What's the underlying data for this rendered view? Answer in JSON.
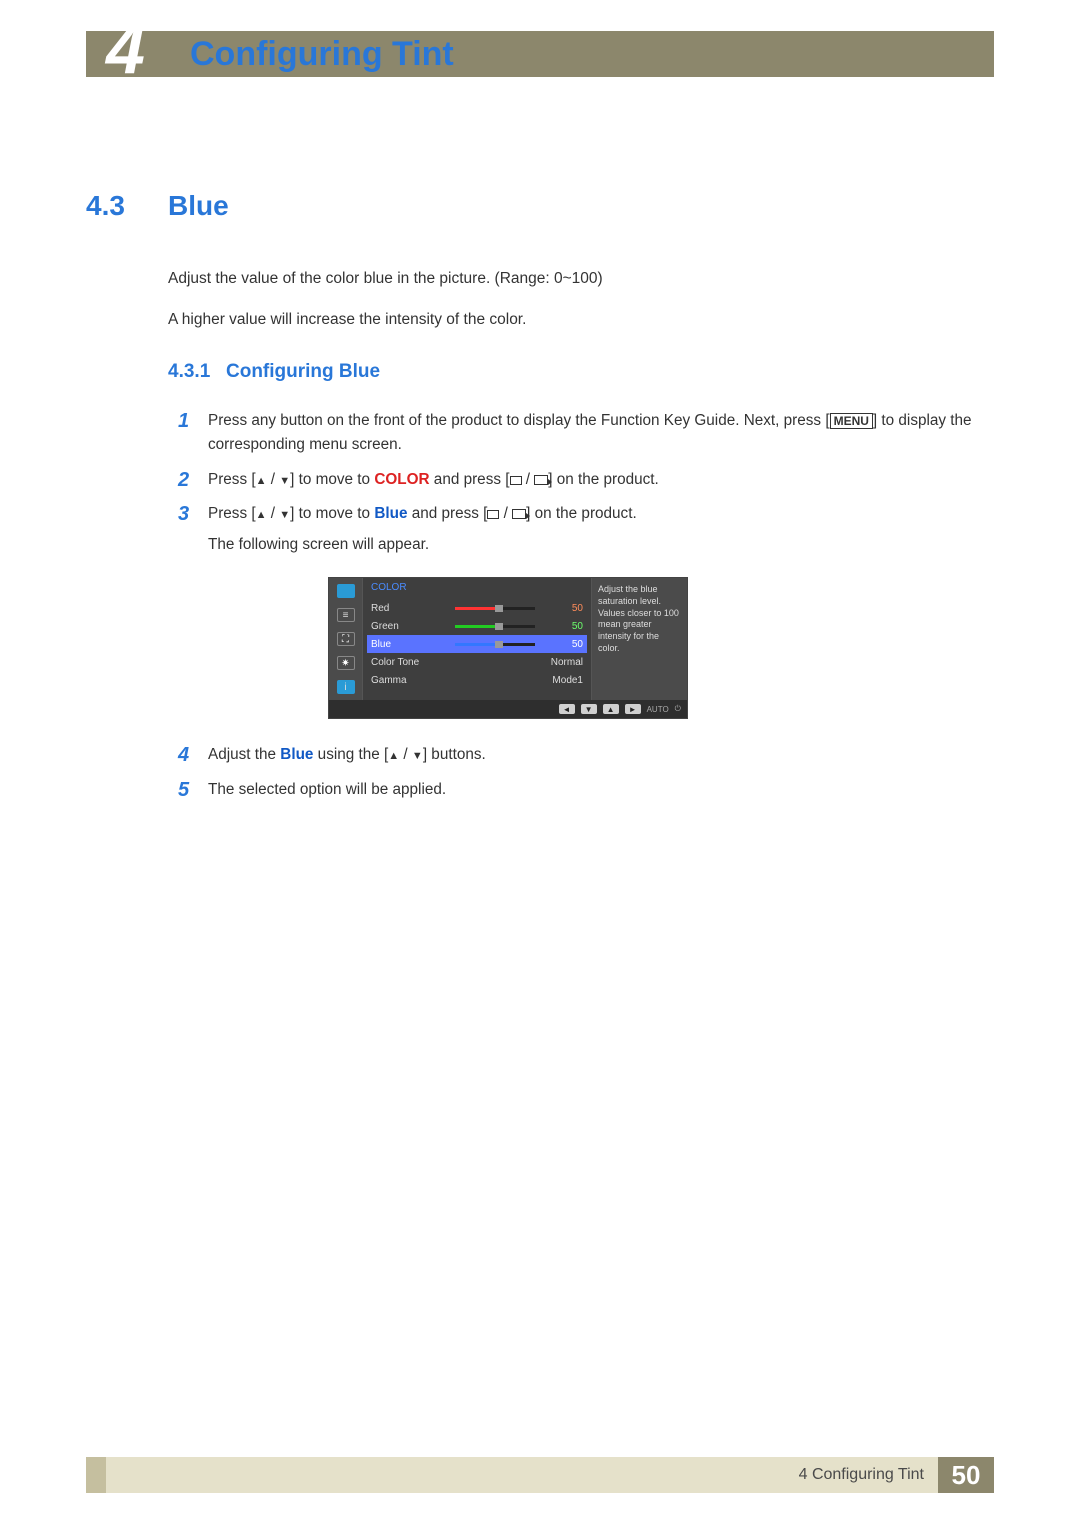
{
  "header": {
    "chapter_emblem": "4",
    "chapter_title": "Configuring Tint"
  },
  "section": {
    "number": "4.3",
    "title": "Blue",
    "para1": "Adjust the value of the color blue in the picture. (Range: 0~100)",
    "para2": "A higher value will increase the intensity of the color."
  },
  "subsection": {
    "number": "4.3.1",
    "title": "Configuring Blue"
  },
  "steps": {
    "s1_pre": "Press any button on the front of the product to display the Function Key Guide. Next, press [",
    "s1_btn": "MENU",
    "s1_post": "] to display the corresponding menu screen.",
    "s2_pre": "Press [",
    "s2_mid1": "] to move to ",
    "s2_kw": "COLOR",
    "s2_mid2": " and press [",
    "s2_post": "] on the product.",
    "s3_pre": "Press [",
    "s3_mid1": "] to move to ",
    "s3_kw": "Blue",
    "s3_mid2": " and press [",
    "s3_post": "] on the product.",
    "s3_follow": "The following screen will appear.",
    "s4_pre": "Adjust the ",
    "s4_kw": "Blue",
    "s4_mid": " using the [",
    "s4_post": "] buttons.",
    "s5": "The selected option will be applied."
  },
  "step_nums": {
    "n1": "1",
    "n2": "2",
    "n3": "3",
    "n4": "4",
    "n5": "5"
  },
  "osd": {
    "title": "COLOR",
    "rows": {
      "red": {
        "label": "Red",
        "value": "50"
      },
      "green": {
        "label": "Green",
        "value": "50"
      },
      "blue": {
        "label": "Blue",
        "value": "50"
      },
      "colortone": {
        "label": "Color Tone",
        "value": "Normal"
      },
      "gamma": {
        "label": "Gamma",
        "value": "Mode1"
      }
    },
    "help": "Adjust the blue saturation level. Values closer to 100 mean greater intensity for the color.",
    "nav_auto": "AUTO"
  },
  "footer": {
    "chapter_ref": "4 Configuring Tint",
    "page_number": "50"
  }
}
